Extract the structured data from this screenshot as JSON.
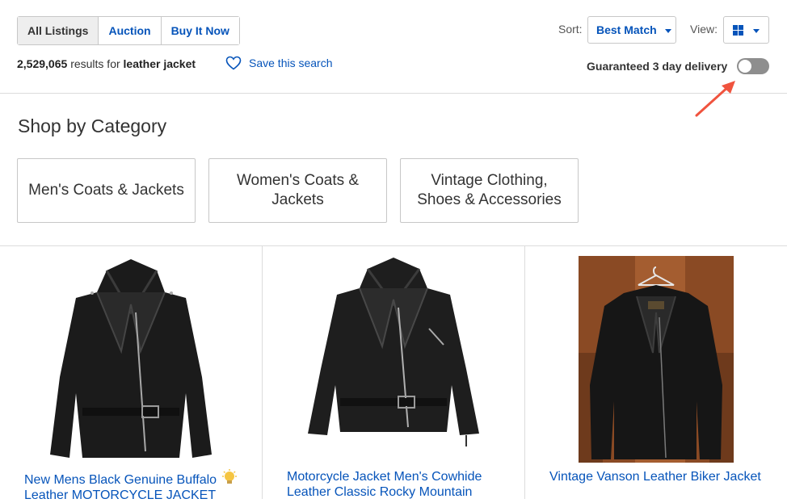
{
  "tabs": [
    {
      "label": "All Listings",
      "active": true
    },
    {
      "label": "Auction",
      "active": false
    },
    {
      "label": "Buy It Now",
      "active": false
    }
  ],
  "results": {
    "count": "2,529,065",
    "text": "results for",
    "query": "leather jacket"
  },
  "save_search": {
    "label": "Save this search",
    "icon": "heart-outline-icon"
  },
  "sort": {
    "label": "Sort:",
    "value": "Best Match"
  },
  "view": {
    "label": "View:",
    "icon": "grid-view-icon"
  },
  "delivery": {
    "label": "Guaranteed 3 day delivery",
    "toggle_on": false
  },
  "categories": {
    "title": "Shop by Category",
    "items": [
      {
        "label": "Men's Coats & Jackets"
      },
      {
        "label": "Women's Coats & Jackets"
      },
      {
        "label": "Vintage Clothing, Shoes & Accessories"
      }
    ]
  },
  "listings": [
    {
      "title_line1": "New Mens Black Genuine Buffalo",
      "title_line2": "Leather MOTORCYCLE JACKET",
      "badge": "lightbulb-icon",
      "image": "black-leather-motorcycle-jacket-image"
    },
    {
      "title_line1": "Motorcycle Jacket Men's Cowhide",
      "title_line2": "Leather Classic Rocky Mountain",
      "image": "black-leather-biker-jacket-image"
    },
    {
      "title_line1": "Vintage Vanson Leather Biker Jacket",
      "title_line2": "",
      "image": "vintage-leather-jacket-on-hanger-photo"
    }
  ],
  "colors": {
    "link": "#0654ba",
    "annotation_arrow": "#f0533e",
    "toggle_off": "#8e8e8e"
  }
}
